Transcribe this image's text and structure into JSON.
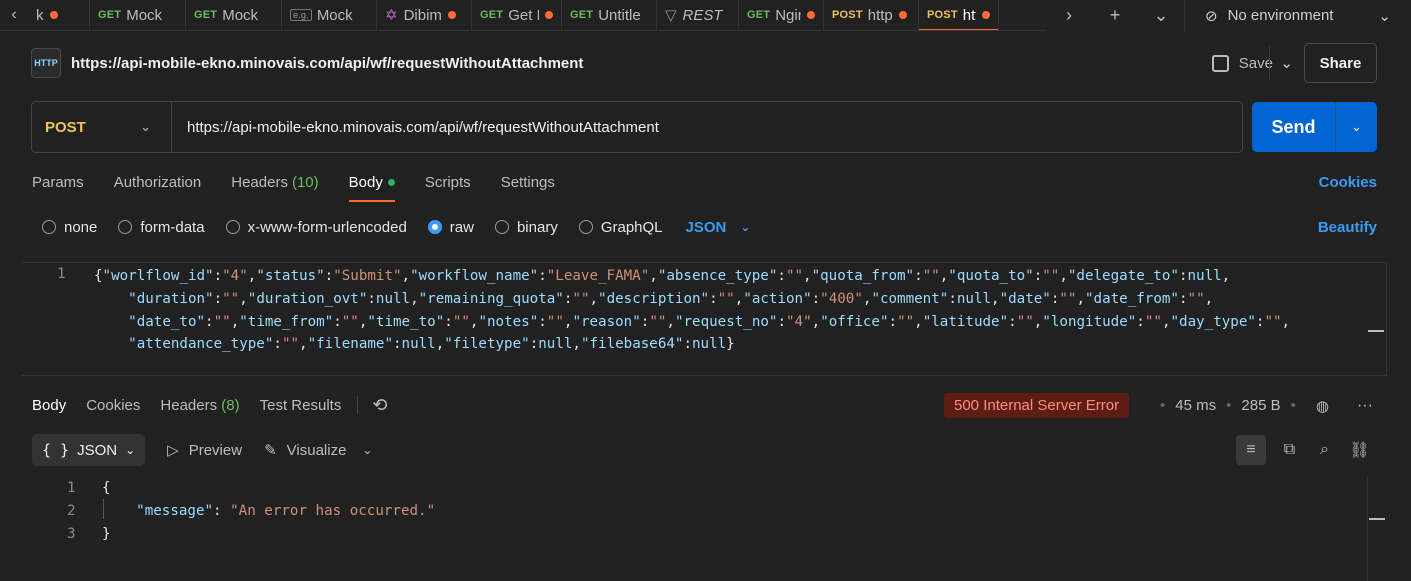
{
  "tabs": [
    {
      "method": "",
      "label": "k",
      "dot": true
    },
    {
      "method": "GET",
      "label": "Mock",
      "dot": false
    },
    {
      "method": "GET",
      "label": "Mock",
      "dot": false
    },
    {
      "method": "e.g.",
      "label": "Mock",
      "dot": false
    },
    {
      "method": "",
      "label": "Dibim",
      "dot": true
    },
    {
      "method": "GET",
      "label": "Get F",
      "dot": true
    },
    {
      "method": "GET",
      "label": "Untitle",
      "dot": false
    },
    {
      "method": "",
      "label": "REST",
      "dot": false
    },
    {
      "method": "GET",
      "label": "Ngin",
      "dot": true
    },
    {
      "method": "POST",
      "label": "http",
      "dot": true
    },
    {
      "method": "POST",
      "label": "http",
      "dot": true,
      "active": true
    }
  ],
  "environment": {
    "label": "No environment"
  },
  "request": {
    "title": "https://api-mobile-ekno.minovais.com/api/wf/requestWithoutAttachment",
    "http_icon": "HTTP",
    "save_label": "Save",
    "share_label": "Share",
    "method": "POST",
    "url": "https://api-mobile-ekno.minovais.com/api/wf/requestWithoutAttachment",
    "send_label": "Send"
  },
  "request_tabs": {
    "params": "Params",
    "authorization": "Authorization",
    "headers": "Headers",
    "headers_count": "(10)",
    "body": "Body",
    "scripts": "Scripts",
    "settings": "Settings",
    "cookies": "Cookies"
  },
  "body_options": {
    "none": "none",
    "form_data": "form-data",
    "urlencoded": "x-www-form-urlencoded",
    "raw": "raw",
    "binary": "binary",
    "graphql": "GraphQL",
    "format": "JSON",
    "beautify": "Beautify"
  },
  "request_body": {
    "line_number": "1",
    "pairs": [
      [
        "worlflow_id",
        "\"4\""
      ],
      [
        "status",
        "\"Submit\""
      ],
      [
        "workflow_name",
        "\"Leave_FAMA\""
      ],
      [
        "absence_type",
        "\"\""
      ],
      [
        "quota_from",
        "\"\""
      ],
      [
        "quota_to",
        "\"\""
      ],
      [
        "delegate_to",
        "null"
      ],
      [
        "duration",
        "\"\""
      ],
      [
        "duration_ovt",
        "null"
      ],
      [
        "remaining_quota",
        "\"\""
      ],
      [
        "description",
        "\"\""
      ],
      [
        "action",
        "\"400\""
      ],
      [
        "comment",
        "null"
      ],
      [
        "date",
        "\"\""
      ],
      [
        "date_from",
        "\"\""
      ],
      [
        "date_to",
        "\"\""
      ],
      [
        "time_from",
        "\"\""
      ],
      [
        "time_to",
        "\"\""
      ],
      [
        "notes",
        "\"\""
      ],
      [
        "reason",
        "\"\""
      ],
      [
        "request_no",
        "\"4\""
      ],
      [
        "office",
        "\"\""
      ],
      [
        "latitude",
        "\"\""
      ],
      [
        "longitude",
        "\"\""
      ],
      [
        "day_type",
        "\"\""
      ],
      [
        "attendance_type",
        "\"\""
      ],
      [
        "filename",
        "null"
      ],
      [
        "filetype",
        "null"
      ],
      [
        "filebase64",
        "null"
      ]
    ]
  },
  "response_tabs": {
    "body": "Body",
    "cookies": "Cookies",
    "headers": "Headers",
    "headers_count": "(8)",
    "test_results": "Test Results"
  },
  "response_meta": {
    "status": "500 Internal Server Error",
    "time": "45 ms",
    "size": "285 B"
  },
  "response_toolbar": {
    "format": "JSON",
    "preview": "Preview",
    "visualize": "Visualize"
  },
  "response_body": {
    "lines": [
      "1",
      "2",
      "3"
    ],
    "open": "{",
    "key": "\"message\"",
    "value": "\"An error has occurred.\"",
    "close": "}"
  },
  "colors": {
    "accent": "#ff6c37",
    "send": "#0265d2",
    "link": "#3a9bf4",
    "get": "#6bbd5b",
    "post": "#f0c35a",
    "error_bg": "#5c1e14",
    "error_fg": "#ff8c7a"
  }
}
